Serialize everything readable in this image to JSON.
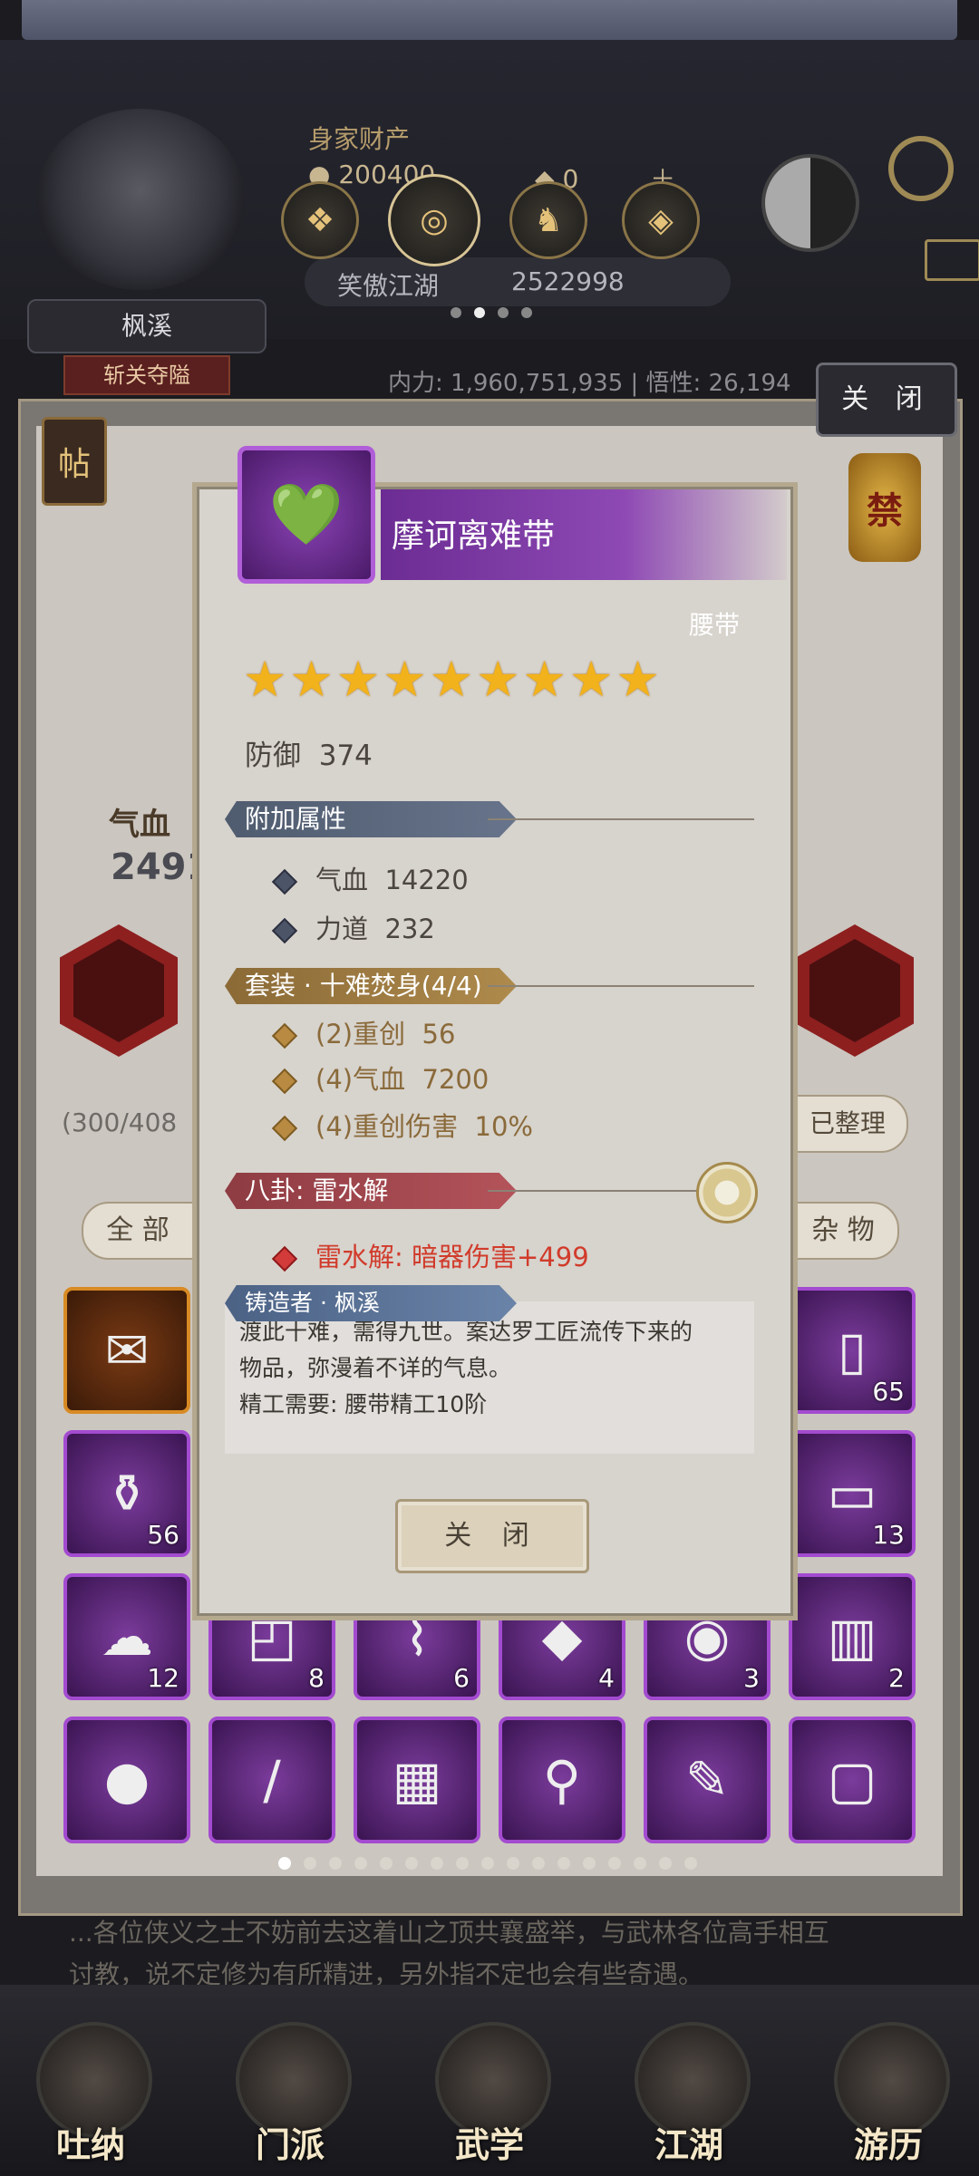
{
  "header": {
    "wealth_label": "身家财产",
    "gold": "200400",
    "jade": "0",
    "title_name": "笑傲江湖",
    "title_id": "2522998",
    "player_name": "枫溪",
    "player_badge": "斩关夺隘",
    "power_text": "内力: 1,960,751,935 | 悟性: 26,194",
    "equip_page_dots": 4,
    "equip_page_active": 1
  },
  "panel": {
    "tie_label": "帖",
    "forbidden_label": "禁",
    "close_label": "关 闭",
    "hp_label": "气血",
    "hp_value_partial": "2491",
    "bag_count": "(300/408",
    "sort_label": "已整理",
    "tab_all": "全 部",
    "tab_misc": "杂 物",
    "grid_counts": [
      "",
      "",
      "",
      "",
      "",
      "65",
      "56",
      "",
      "",
      "",
      "",
      "13",
      "12",
      "8",
      "6",
      "4",
      "3",
      "2",
      "",
      "",
      "",
      "",
      "",
      ""
    ],
    "page_dots": 17,
    "story_line1": "...各位侠义之士不妨前去这着山之顶共襄盛举，与武林各位高手相互",
    "story_line2": "讨教，说不定修为有所精进，另外指不定也会有些奇遇。"
  },
  "dialog": {
    "item_name": "摩诃离难带",
    "slot_type": "腰带",
    "star_count": 9,
    "defense_label": "防御",
    "defense_value": "374",
    "extra_header": "附加属性",
    "extra_attrs": [
      {
        "name": "气血",
        "value": "14220"
      },
      {
        "name": "力道",
        "value": "232"
      }
    ],
    "set_header": "套装 · 十难焚身(4/4)",
    "set_attrs": [
      {
        "name": "(2)重创",
        "value": "56"
      },
      {
        "name": "(4)气血",
        "value": "7200"
      },
      {
        "name": "(4)重创伤害",
        "value": "10%"
      }
    ],
    "bagua_header": "八卦: 雷水解",
    "bagua_effect": "雷水解: 暗器伤害+499",
    "maker_header": "铸造者 · 枫溪",
    "desc_line1": "渡此十难，需得九世。案达罗工匠流传下来的",
    "desc_line2": "物品，弥漫着不详的气息。",
    "desc_line3": "精工需要: 腰带精工10阶",
    "close_label": "关 闭"
  },
  "nav": {
    "items": [
      "吐纳",
      "门派",
      "武学",
      "江湖",
      "游历"
    ]
  },
  "colors": {
    "purple_rarity": "#8e49b4",
    "star": "#f2b21b",
    "red_effect": "#d13b2b"
  }
}
